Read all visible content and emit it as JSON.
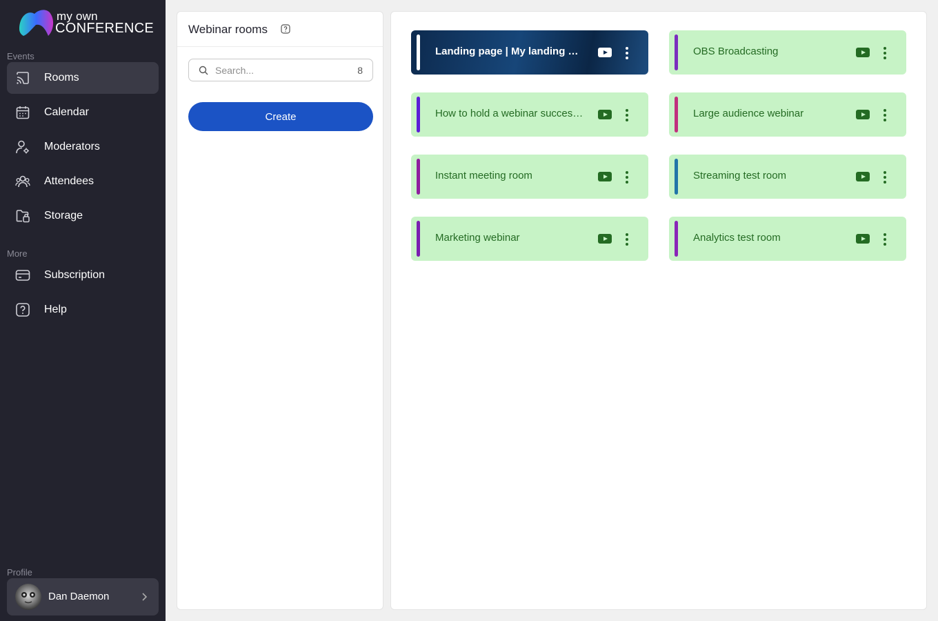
{
  "app": {
    "logo_top": "my own",
    "logo_bottom": "CONFERENCE"
  },
  "sidebar": {
    "events_label": "Events",
    "more_label": "More",
    "profile_label": "Profile",
    "items": [
      {
        "label": "Rooms",
        "icon": "cast-icon"
      },
      {
        "label": "Calendar",
        "icon": "calendar-icon"
      },
      {
        "label": "Moderators",
        "icon": "user-gear-icon"
      },
      {
        "label": "Attendees",
        "icon": "users-icon"
      },
      {
        "label": "Storage",
        "icon": "folder-icon"
      },
      {
        "label": "Subscription",
        "icon": "card-icon"
      },
      {
        "label": "Help",
        "icon": "help-icon"
      }
    ],
    "profile_name": "Dan Daemon"
  },
  "panel": {
    "title": "Webinar rooms",
    "search_placeholder": "Search...",
    "search_count": "8",
    "create_label": "Create"
  },
  "rooms": [
    {
      "name": "Landing page  |  My landing page",
      "bar_color": "#ffffff",
      "style": "dark"
    },
    {
      "name": "OBS Broadcasting",
      "bar_color": "#7b2fbe",
      "style": "light"
    },
    {
      "name": "How to hold a webinar successfully",
      "bar_color": "#5b1fd6",
      "style": "light"
    },
    {
      "name": "Large audience webinar",
      "bar_color": "#c0307e",
      "style": "light"
    },
    {
      "name": "Instant meeting room",
      "bar_color": "#8f1f9e",
      "style": "light"
    },
    {
      "name": "Streaming test room",
      "bar_color": "#2275a8",
      "style": "light"
    },
    {
      "name": "Marketing webinar",
      "bar_color": "#7a1fb0",
      "style": "light"
    },
    {
      "name": "Analytics test room",
      "bar_color": "#8a25b8",
      "style": "light"
    }
  ]
}
